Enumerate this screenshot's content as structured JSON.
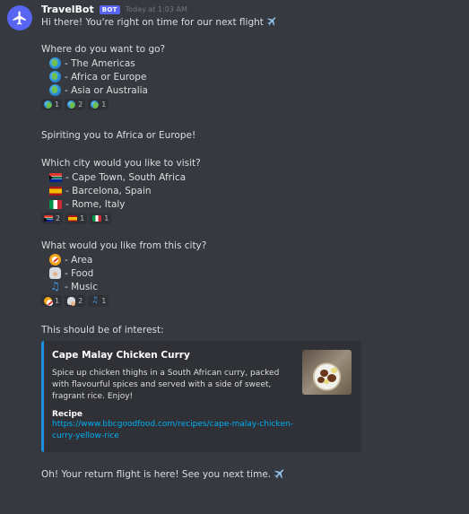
{
  "bot": {
    "username": "TravelBot",
    "tag": "BOT",
    "timestamp": "Today at 1:03 AM"
  },
  "messages": {
    "greeting": "Hi there! You're right on time for our next flight",
    "q1": "Where do you want to go?",
    "q1_options": [
      "- The Americas",
      "- Africa or Europe",
      "- Asia or Australia"
    ],
    "q1_reactions": [
      "1",
      "2",
      "1"
    ],
    "spiriting": "Spiriting you to Africa or Europe!",
    "q2": "Which city would you like to visit?",
    "q2_options": [
      "- Cape Town, South Africa",
      "- Barcelona, Spain",
      "- Rome, Italy"
    ],
    "q2_reactions": [
      "2",
      "1",
      "1"
    ],
    "q3": "What would you like from this city?",
    "q3_options": [
      "- Area",
      "- Food",
      "- Music"
    ],
    "q3_reactions": [
      "1",
      "2",
      "1"
    ],
    "interest": "This should be of interest:",
    "farewell": "Oh! Your return flight is here! See you next time."
  },
  "embed": {
    "accent": "#1e90e0",
    "title": "Cape Malay Chicken Curry",
    "description": "Spice up chicken thighs in a South African curry, packed with flavourful spices and served with a side of sweet, fragrant rice. Enjoy!",
    "field_name": "Recipe",
    "field_value": "https://www.bbcgoodfood.com/recipes/cape-malay-chicken-curry-yellow-rice"
  },
  "icons": {
    "airplane": "airplane-icon",
    "globe": "globe-icon",
    "flags": [
      "south-africa-flag-icon",
      "spain-flag-icon",
      "italy-flag-icon"
    ],
    "categories": [
      "compass-icon",
      "chef-icon",
      "music-note-icon"
    ]
  },
  "colors": {
    "background": "#36393f",
    "blurple": "#5865f2",
    "link": "#00aff4"
  }
}
